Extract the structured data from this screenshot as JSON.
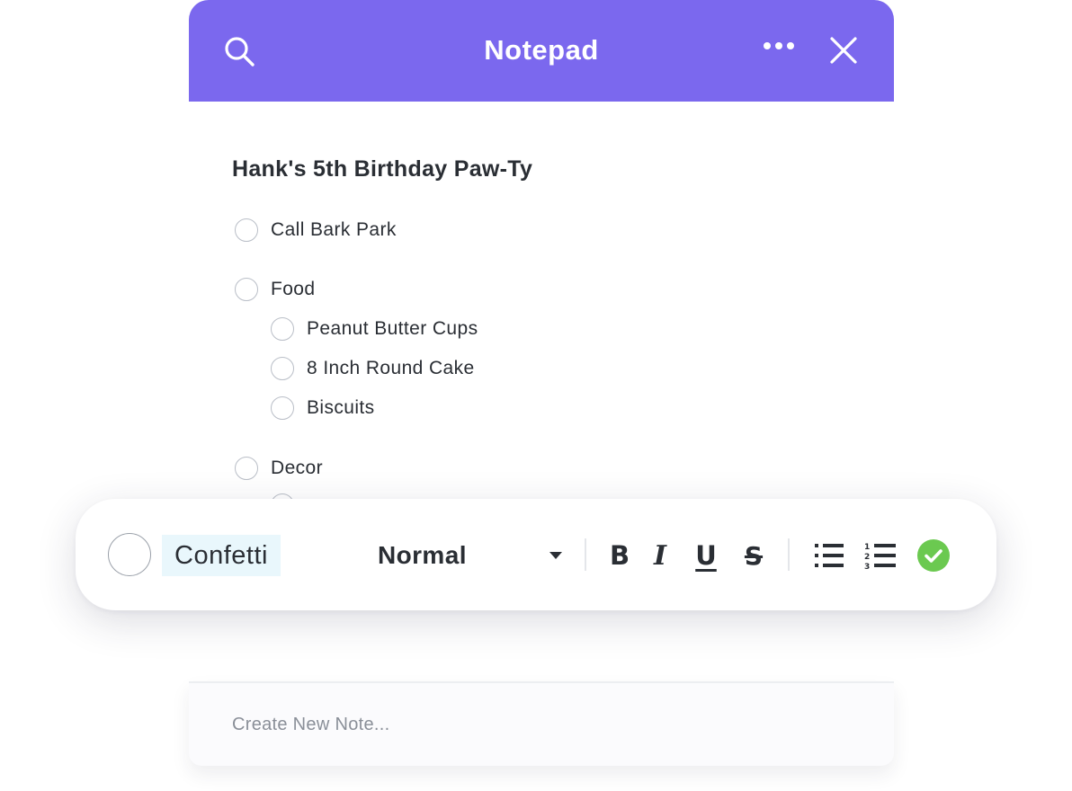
{
  "header": {
    "title": "Notepad",
    "icons": [
      "search-icon",
      "more-icon",
      "close-icon"
    ],
    "background": "#7b68ee"
  },
  "note": {
    "title": "Hank's 5th Birthday Paw-Ty",
    "items": [
      {
        "label": "Call Bark Park",
        "level": 0,
        "checked": false
      },
      {
        "label": "Food",
        "level": 0,
        "checked": false
      },
      {
        "label": "Peanut Butter Cups",
        "level": 1,
        "checked": false
      },
      {
        "label": "8 Inch Round Cake",
        "level": 1,
        "checked": false
      },
      {
        "label": "Biscuits",
        "level": 1,
        "checked": false
      },
      {
        "label": "Decor",
        "level": 0,
        "checked": false
      }
    ]
  },
  "editor": {
    "input_value": "Confetti",
    "text_style": "Normal",
    "format_buttons": [
      "B",
      "I",
      "U",
      "S"
    ],
    "icons": [
      "bullet-list-icon",
      "numbered-list-icon",
      "confirm-check-icon"
    ],
    "confirm_color": "#6bc950"
  },
  "footer": {
    "create_placeholder": "Create New Note..."
  }
}
